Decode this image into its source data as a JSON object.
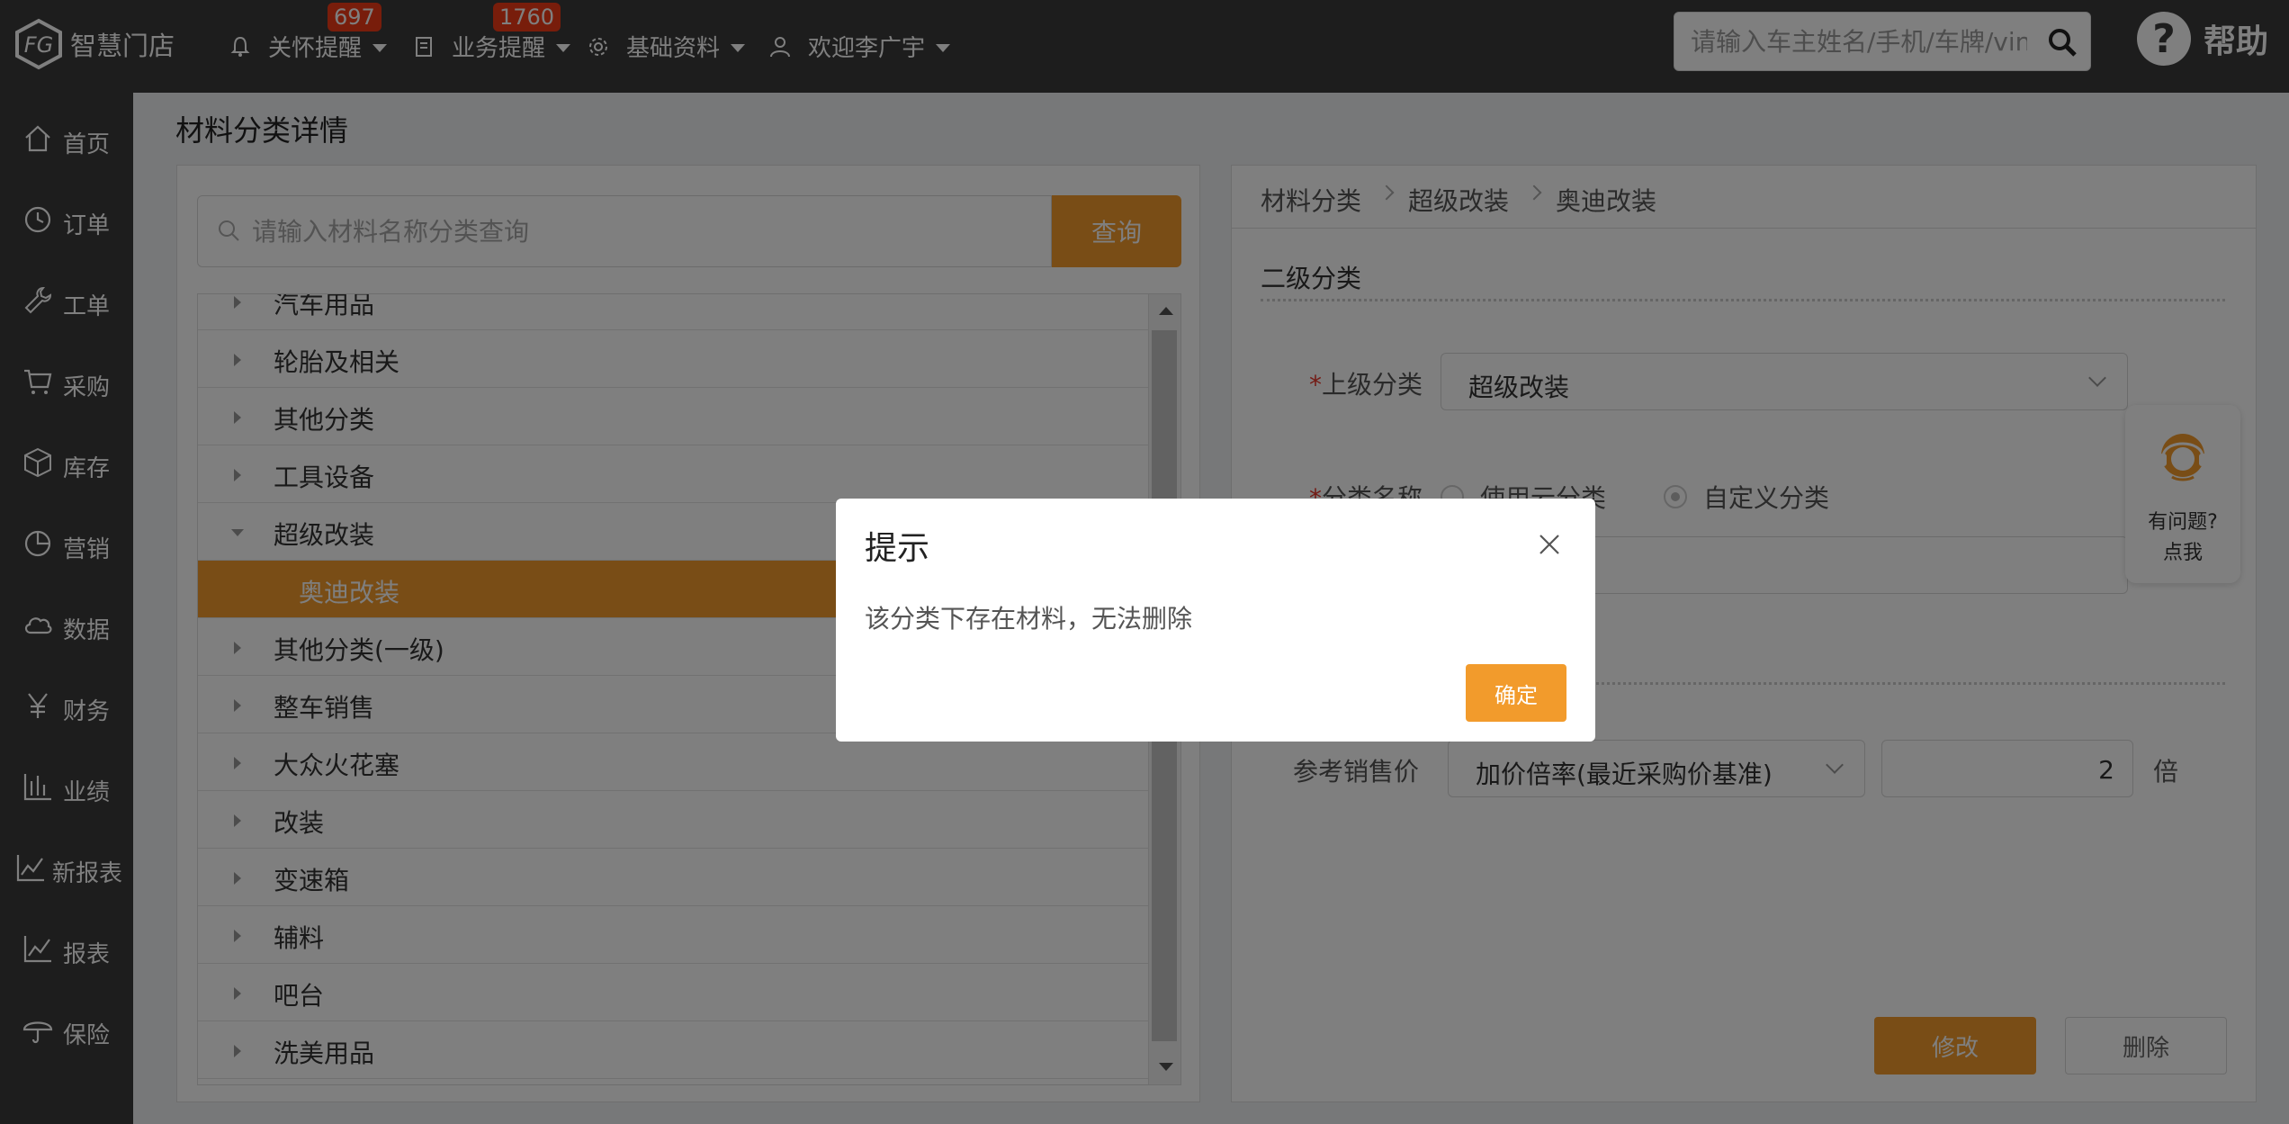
{
  "app": {
    "logo_text": "智慧门店"
  },
  "topnav": {
    "care": {
      "label": "关怀提醒",
      "badge": "697"
    },
    "business": {
      "label": "业务提醒",
      "badge": "1760"
    },
    "basics": {
      "label": "基础资料"
    },
    "user": {
      "label": "欢迎李广宇"
    },
    "search_placeholder": "请输入车主姓名/手机/车牌/vin码",
    "help": "帮助"
  },
  "sidebar": {
    "items": [
      {
        "label": "首页",
        "icon": "home-icon"
      },
      {
        "label": "订单",
        "icon": "clock-icon"
      },
      {
        "label": "工单",
        "icon": "wrench-icon"
      },
      {
        "label": "采购",
        "icon": "cart-icon"
      },
      {
        "label": "库存",
        "icon": "box-icon"
      },
      {
        "label": "营销",
        "icon": "pie-icon"
      },
      {
        "label": "数据",
        "icon": "cloud-icon"
      },
      {
        "label": "财务",
        "icon": "yen-icon"
      },
      {
        "label": "业绩",
        "icon": "bar-chart-icon"
      },
      {
        "label": "新报表",
        "icon": "line-chart-icon"
      },
      {
        "label": "报表",
        "icon": "line-chart-icon"
      },
      {
        "label": "保险",
        "icon": "umbrella-icon"
      }
    ]
  },
  "page": {
    "title": "材料分类详情"
  },
  "left": {
    "search_placeholder": "请输入材料名称分类查询",
    "query_button": "查询",
    "tree": [
      {
        "label": "汽车用品",
        "expanded": false
      },
      {
        "label": "轮胎及相关",
        "expanded": false
      },
      {
        "label": "其他分类",
        "expanded": false
      },
      {
        "label": "工具设备",
        "expanded": false
      },
      {
        "label": "超级改装",
        "expanded": true
      },
      {
        "label": "奥迪改装",
        "child": true,
        "selected": true
      },
      {
        "label": "其他分类(一级)",
        "expanded": false
      },
      {
        "label": "整车销售",
        "expanded": false
      },
      {
        "label": "大众火花塞",
        "expanded": false
      },
      {
        "label": "改装",
        "expanded": false
      },
      {
        "label": "变速箱",
        "expanded": false
      },
      {
        "label": "辅料",
        "expanded": false
      },
      {
        "label": "吧台",
        "expanded": false
      },
      {
        "label": "洗美用品",
        "expanded": false
      }
    ]
  },
  "right": {
    "breadcrumb": [
      "材料分类",
      "超级改装",
      "奥迪改装"
    ],
    "section_title": "二级分类",
    "parent_label": "上级分类",
    "parent_value": "超级改装",
    "name_label": "分类名称",
    "radio_cloud": "使用云分类",
    "radio_custom": "自定义分类",
    "price_label": "参考销售价",
    "price_mode": "加价倍率(最近采购价基准)",
    "multiplier": "2",
    "unit": "倍",
    "modify_button": "修改",
    "delete_button": "删除"
  },
  "float_help": {
    "line1": "有问题?",
    "line2": "点我"
  },
  "dialog": {
    "title": "提示",
    "message": "该分类下存在材料，无法删除",
    "ok": "确定"
  },
  "colors": {
    "accent": "#f29b2c",
    "topbar": "#3a3a3a",
    "badge": "#f03a17"
  }
}
